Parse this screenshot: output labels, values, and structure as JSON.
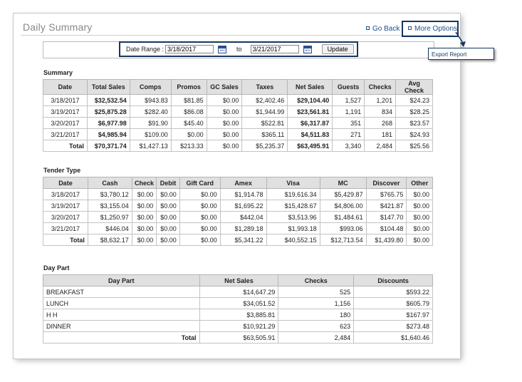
{
  "header": {
    "title": "Daily Summary",
    "go_back": "Go Back",
    "more_options": "More Options"
  },
  "date_range": {
    "label": "Date Range :",
    "from": "3/18/2017",
    "to_label": "to",
    "to": "3/21/2017",
    "update": "Update"
  },
  "export_report": "Export Report",
  "summary": {
    "title": "Summary",
    "columns": [
      "Date",
      "Total Sales",
      "Comps",
      "Promos",
      "GC Sales",
      "Taxes",
      "Net Sales",
      "Guests",
      "Checks",
      "Avg Check"
    ],
    "rows": [
      [
        "3/18/2017",
        "$32,532.54",
        "$943.83",
        "$81.85",
        "$0.00",
        "$2,402.46",
        "$29,104.40",
        "1,527",
        "1,201",
        "$24.23"
      ],
      [
        "3/19/2017",
        "$25,875.28",
        "$282.40",
        "$86.08",
        "$0.00",
        "$1,944.99",
        "$23,561.81",
        "1,191",
        "834",
        "$28.25"
      ],
      [
        "3/20/2017",
        "$6,977.98",
        "$91.90",
        "$45.40",
        "$0.00",
        "$522.81",
        "$6,317.87",
        "351",
        "268",
        "$23.57"
      ],
      [
        "3/21/2017",
        "$4,985.94",
        "$109.00",
        "$0.00",
        "$0.00",
        "$365.11",
        "$4,511.83",
        "271",
        "181",
        "$24.93"
      ]
    ],
    "total": [
      "Total",
      "$70,371.74",
      "$1,427.13",
      "$213.33",
      "$0.00",
      "$5,235.37",
      "$63,495.91",
      "3,340",
      "2,484",
      "$25.56"
    ]
  },
  "tender": {
    "title": "Tender Type",
    "columns": [
      "Date",
      "Cash",
      "Check",
      "Debit",
      "Gift Card",
      "Amex",
      "Visa",
      "MC",
      "Discover",
      "Other"
    ],
    "rows": [
      [
        "3/18/2017",
        "$3,780.12",
        "$0.00",
        "$0.00",
        "$0.00",
        "$1,914.78",
        "$19,616.34",
        "$5,429.87",
        "$765.75",
        "$0.00"
      ],
      [
        "3/19/2017",
        "$3,155.04",
        "$0.00",
        "$0.00",
        "$0.00",
        "$1,695.22",
        "$15,428.67",
        "$4,806.00",
        "$421.87",
        "$0.00"
      ],
      [
        "3/20/2017",
        "$1,250.97",
        "$0.00",
        "$0.00",
        "$0.00",
        "$442.04",
        "$3,513.96",
        "$1,484.61",
        "$147.70",
        "$0.00"
      ],
      [
        "3/21/2017",
        "$446.04",
        "$0.00",
        "$0.00",
        "$0.00",
        "$1,289.18",
        "$1,993.18",
        "$993.06",
        "$104.48",
        "$0.00"
      ]
    ],
    "total": [
      "Total",
      "$8,632.17",
      "$0.00",
      "$0.00",
      "$0.00",
      "$5,341.22",
      "$40,552.15",
      "$12,713.54",
      "$1,439.80",
      "$0.00"
    ]
  },
  "daypart": {
    "title": "Day Part",
    "columns": [
      "Day Part",
      "Net Sales",
      "Checks",
      "Discounts"
    ],
    "rows": [
      [
        "BREAKFAST",
        "$14,647.29",
        "525",
        "$593.22"
      ],
      [
        "LUNCH",
        "$34,051.52",
        "1,156",
        "$605.79"
      ],
      [
        "H H",
        "$3,885.81",
        "180",
        "$167.97"
      ],
      [
        "DINNER",
        "$10,921.29",
        "623",
        "$273.48"
      ]
    ],
    "total": [
      "Total",
      "$63,505.91",
      "2,484",
      "$1,640.46"
    ]
  }
}
